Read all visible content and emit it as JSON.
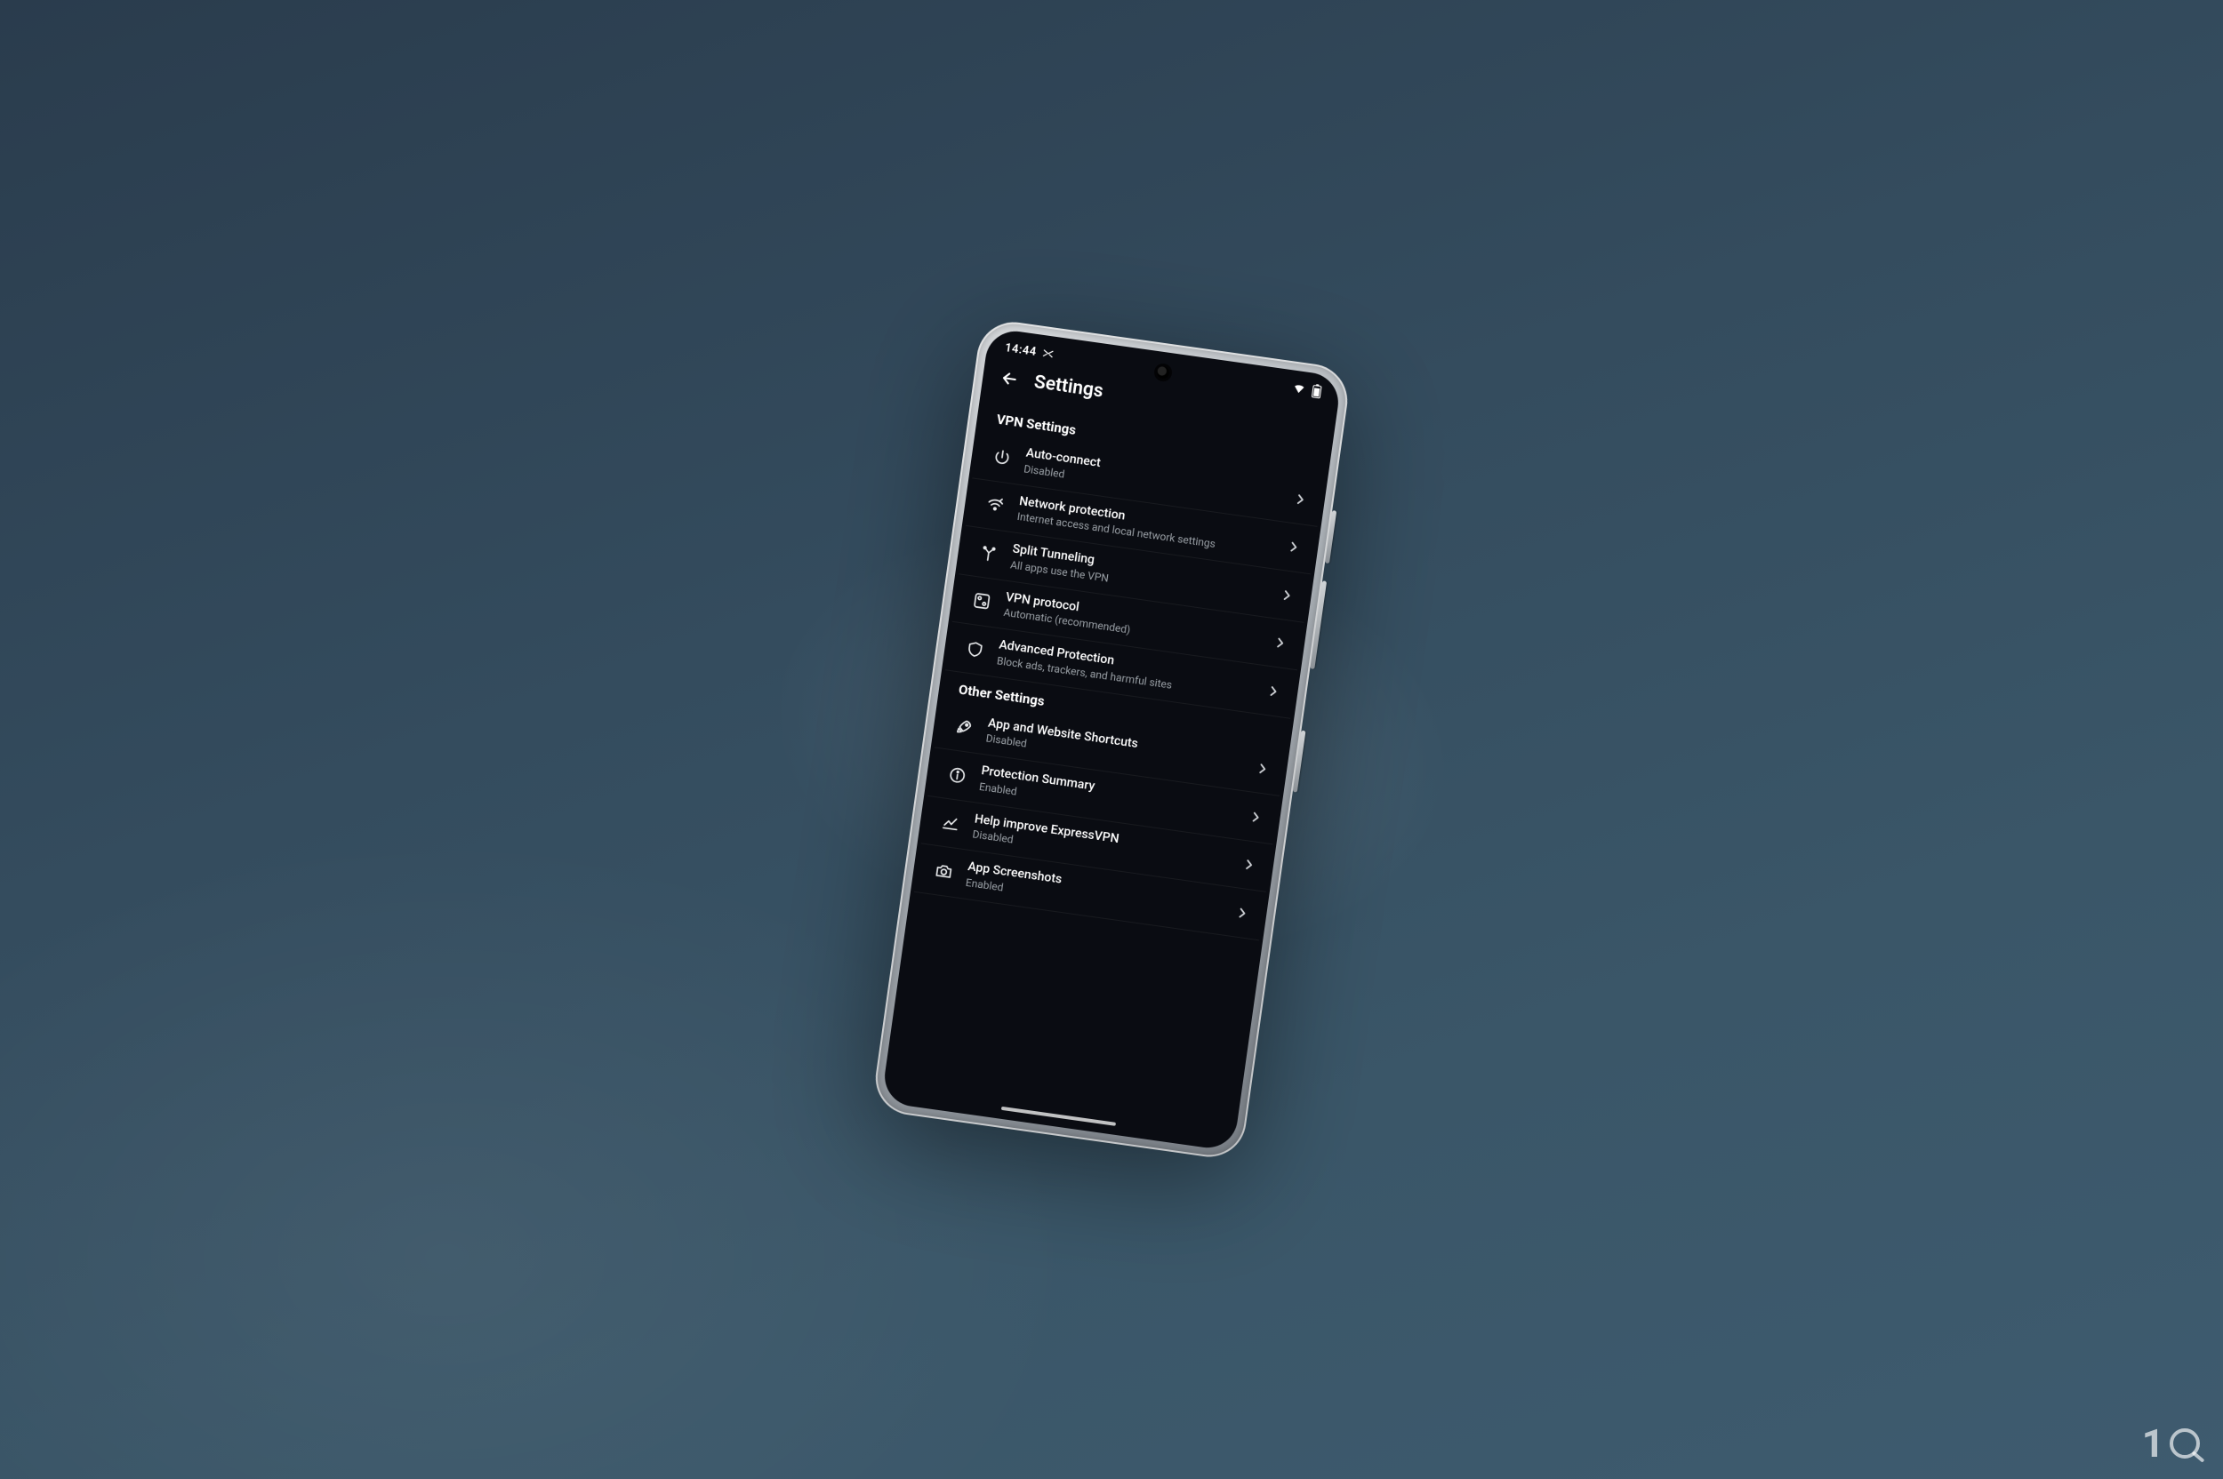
{
  "statusbar": {
    "time": "14:44"
  },
  "header": {
    "title": "Settings"
  },
  "sections": [
    {
      "title": "VPN Settings",
      "items": [
        {
          "icon": "power",
          "name": "auto-connect",
          "title": "Auto-connect",
          "subtitle": "Disabled"
        },
        {
          "icon": "wifi-lock",
          "name": "network-protection",
          "title": "Network protection",
          "subtitle": "Internet access and local network settings"
        },
        {
          "icon": "split",
          "name": "split-tunneling",
          "title": "Split Tunneling",
          "subtitle": "All apps use the VPN"
        },
        {
          "icon": "protocol",
          "name": "vpn-protocol",
          "title": "VPN protocol",
          "subtitle": "Automatic (recommended)"
        },
        {
          "icon": "shield",
          "name": "advanced-protection",
          "title": "Advanced Protection",
          "subtitle": "Block ads, trackers, and harmful sites"
        }
      ]
    },
    {
      "title": "Other Settings",
      "items": [
        {
          "icon": "rocket",
          "name": "app-website-shortcuts",
          "title": "App and Website Shortcuts",
          "subtitle": "Disabled"
        },
        {
          "icon": "info",
          "name": "protection-summary",
          "title": "Protection Summary",
          "subtitle": "Enabled"
        },
        {
          "icon": "chart",
          "name": "help-improve",
          "title": "Help improve ExpressVPN",
          "subtitle": "Disabled"
        },
        {
          "icon": "camera",
          "name": "app-screenshots",
          "title": "App Screenshots",
          "subtitle": "Enabled"
        }
      ]
    }
  ],
  "watermark": "10"
}
